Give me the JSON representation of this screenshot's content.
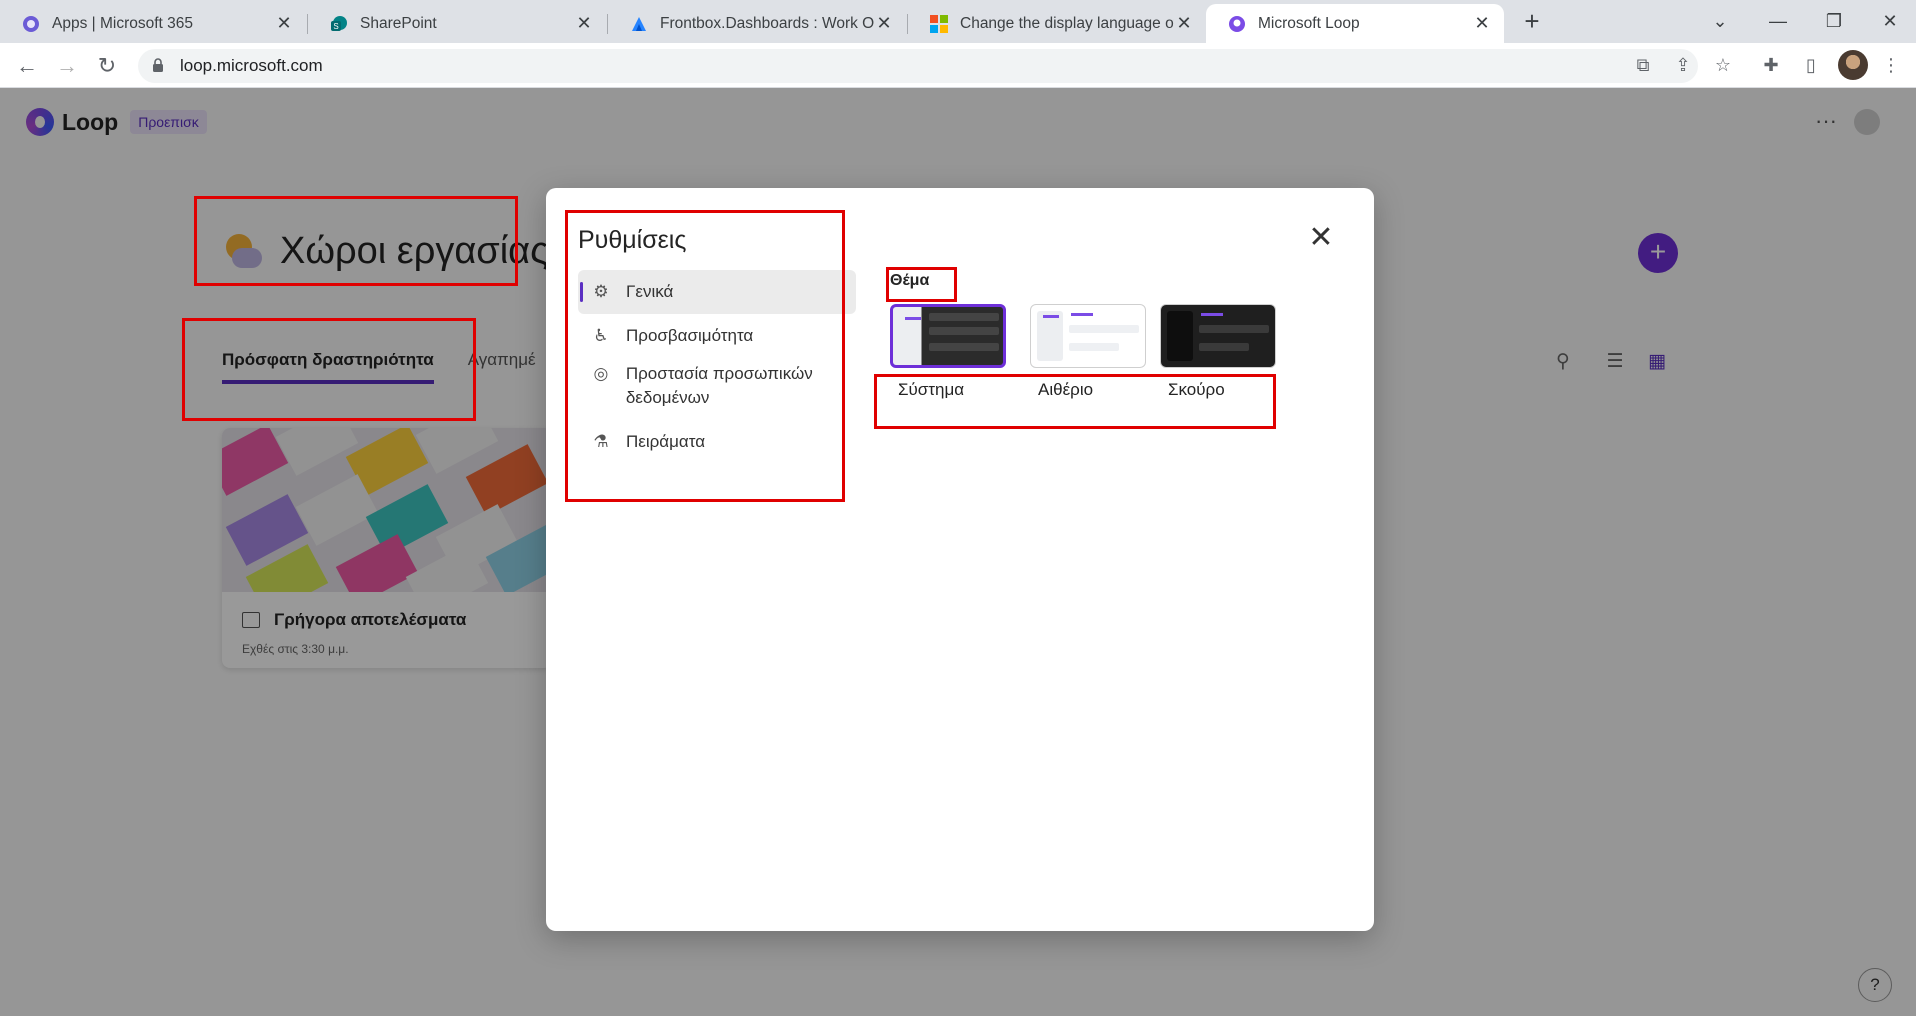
{
  "browser": {
    "tabs": [
      {
        "title": "Apps | Microsoft 365",
        "icon": "m365-icon"
      },
      {
        "title": "SharePoint",
        "icon": "sharepoint-icon"
      },
      {
        "title": "Frontbox.Dashboards : Work Ord",
        "icon": "frontbox-icon"
      },
      {
        "title": "Change the display language of r",
        "icon": "microsoft-icon"
      },
      {
        "title": "Microsoft Loop",
        "icon": "loop-icon"
      }
    ],
    "active_tab_index": 4,
    "url": "loop.microsoft.com"
  },
  "app": {
    "name": "Loop",
    "badge": "Προεπισκ"
  },
  "workspaces": {
    "title": "Χώροι εργασίας",
    "tabs": [
      "Πρόσφατη δραστηριότητα",
      "Αγαπημέ"
    ],
    "card": {
      "title": "Γρήγορα αποτελέσματα",
      "subtitle": "Εχθές στις 3:30 μ.μ."
    }
  },
  "settings_dialog": {
    "title": "Ρυθμίσεις",
    "nav": [
      {
        "label": "Γενικά",
        "icon": "gear-icon",
        "active": true
      },
      {
        "label": "Προσβασιμότητα",
        "icon": "accessibility-icon"
      },
      {
        "label": "Προστασία προσωπικών δεδομένων",
        "icon": "privacy-icon"
      },
      {
        "label": "Πειράματα",
        "icon": "flask-icon"
      }
    ],
    "theme": {
      "label": "Θέμα",
      "options": [
        "Σύστημα",
        "Αιθέριο",
        "Σκούρο"
      ],
      "selected": "Σύστημα"
    }
  },
  "colors": {
    "accent": "#5b2fc2",
    "highlight": "#e00000"
  }
}
